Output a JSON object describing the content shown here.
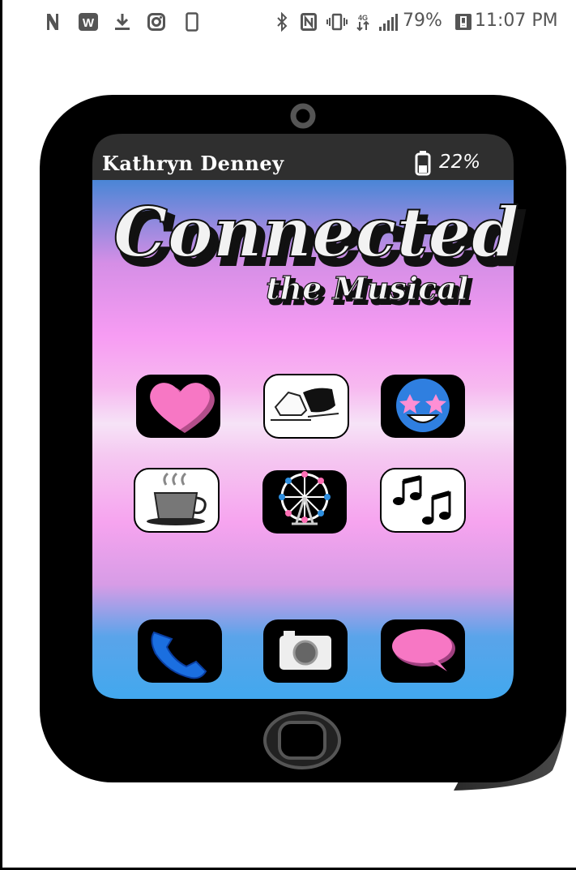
{
  "status_bar": {
    "battery_percent": "79%",
    "time": "11:07 PM",
    "notification_icons": [
      "n-icon",
      "w-icon",
      "download-icon",
      "instagram-icon",
      "phone-outline-icon"
    ],
    "system_icons": [
      "bluetooth-icon",
      "nfc-icon",
      "vibrate-icon",
      "data-icon",
      "signal-icon",
      "battery-saver-icon"
    ]
  },
  "phone_screen": {
    "owner_name": "Kathryn Denney",
    "battery": "22%"
  },
  "title": {
    "main": "Connected",
    "sub": "the Musical"
  },
  "apps": [
    {
      "icon": "heart-icon"
    },
    {
      "icon": "ice-skates-icon"
    },
    {
      "icon": "star-eyes-emoji-icon"
    },
    {
      "icon": "coffee-cup-icon"
    },
    {
      "icon": "ferris-wheel-icon"
    },
    {
      "icon": "music-notes-icon"
    }
  ],
  "dock": [
    {
      "icon": "phone-icon"
    },
    {
      "icon": "camera-icon"
    },
    {
      "icon": "message-bubble-icon"
    }
  ],
  "colors": {
    "screen_top": "#4a86d6",
    "screen_mid": "#f79cf3",
    "screen_light": "#f6e3f7",
    "screen_bottom": "#42a8ee",
    "phone_body": "#000000",
    "heart": "#f777c4"
  }
}
